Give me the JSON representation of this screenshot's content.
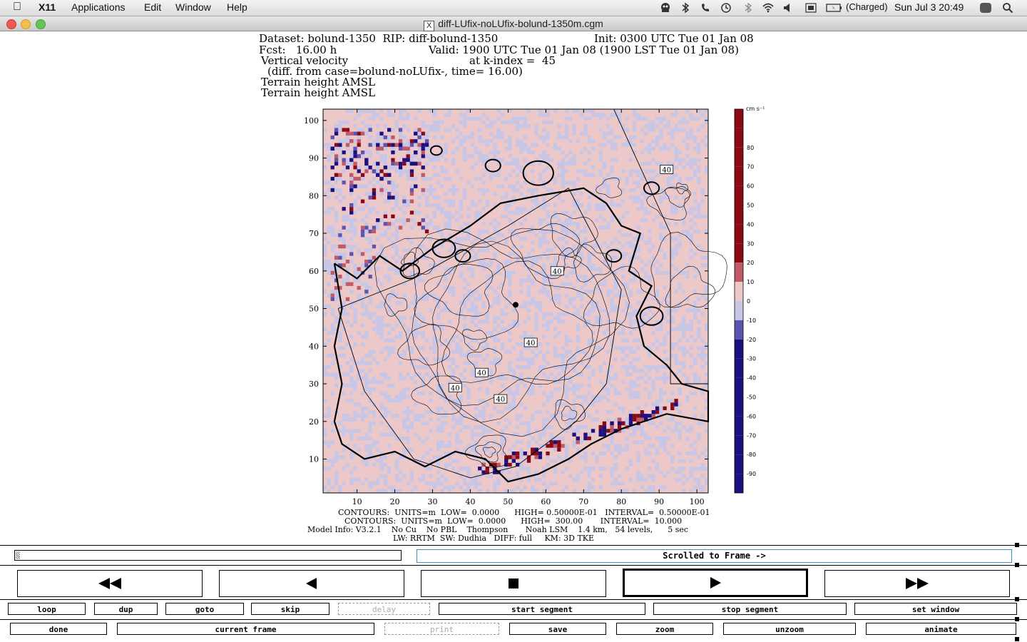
{
  "menubar": {
    "apple": "",
    "app_name": "X11",
    "menus": [
      "Applications",
      "Edit",
      "Window",
      "Help"
    ],
    "battery": "(Charged)",
    "clock": "Sun Jul 3  20:49",
    "status_icons": [
      "ghost-icon",
      "bluetooth-icon",
      "phone-icon",
      "time-machine-icon",
      "bluetooth-icon",
      "wifi-icon",
      "volume-icon",
      "keyboard-icon",
      "battery-icon",
      "user-icon",
      "spotlight-icon"
    ]
  },
  "window": {
    "title": "diff-LUfix-noLUfix-bolund-1350m.cgm",
    "title_icon": "X"
  },
  "plot": {
    "header_line1_left": "Dataset: bolund-1350  RIP: diff-bolund-1350",
    "header_line1_right": "Init: 0300 UTC Tue 01 Jan 08",
    "header_line2_left": "Fcst:   16.00 h",
    "header_line2_right": "Valid: 1900 UTC Tue 01 Jan 08 (1900 LST Tue 01 Jan 08)",
    "header_line3_left": "Vertical velocity",
    "header_line3_right": "at k-index =  45",
    "header_line4": "(diff. from case=bolund-noLUfix-, time= 16.00)",
    "header_line5": "Terrain height AMSL",
    "header_line6": "Terrain height AMSL",
    "colorbar_units": "cm s⁻¹",
    "contour_labels": [
      "40",
      "40",
      "40",
      "40",
      "40",
      "40"
    ],
    "footer_line1": "CONTOURS:  UNITS=m  LOW=  0.0000      HIGH= 0.50000E-01   INTERVAL=  0.50000E-01",
    "footer_line2": "CONTOURS:  UNITS=m  LOW=  0.0000      HIGH=  300.00       INTERVAL=  10.000",
    "footer_line3": "Model Info: V3.2.1    No Cu    No PBL    Thompson       Noah LSM    1.4 km,   54 levels,      5 sec",
    "footer_line4": "LW: RRTM  SW: Dudhia   DIFF: full     KM: 3D TKE"
  },
  "chart_data": {
    "type": "heatmap",
    "title": "Vertical velocity",
    "xlabel": "",
    "ylabel": "",
    "xlim": [
      1,
      103
    ],
    "ylim": [
      1,
      103
    ],
    "x_ticks": [
      10,
      20,
      30,
      40,
      50,
      60,
      70,
      80,
      90,
      100
    ],
    "y_ticks": [
      10,
      20,
      30,
      40,
      50,
      60,
      70,
      80,
      90,
      100
    ],
    "colorbar_ticks": [
      80,
      70,
      60,
      50,
      40,
      30,
      20,
      10,
      0,
      -10,
      -20,
      -30,
      -40,
      -50,
      -60,
      -70,
      -80,
      -90
    ],
    "colorbar_range": [
      -100,
      100
    ],
    "colors": {
      "strong_negative": "#1c1080",
      "negative": "#5b55b0",
      "weak_negative": "#c8c6e6",
      "weak_positive": "#ecc8c8",
      "positive": "#c05a66",
      "strong_positive": "#8a0a14"
    },
    "overlays": [
      "Terrain height AMSL contours (interval 10 m)",
      "Land mask contour"
    ]
  },
  "controls": {
    "frame_status": "Scrolled to Frame ->",
    "nav_buttons": [
      "fast-rewind-icon",
      "step-back-icon",
      "stop-icon",
      "play-icon",
      "fast-forward-icon"
    ],
    "row1": [
      {
        "label": "loop",
        "enabled": true
      },
      {
        "label": "dup",
        "enabled": true
      },
      {
        "label": "goto",
        "enabled": true
      },
      {
        "label": "skip",
        "enabled": true
      },
      {
        "label": "delay",
        "enabled": false
      },
      {
        "label": "start segment",
        "enabled": true
      },
      {
        "label": "stop segment",
        "enabled": true
      },
      {
        "label": "set window",
        "enabled": true
      }
    ],
    "row2": [
      {
        "label": "done",
        "enabled": true
      },
      {
        "label": "current frame",
        "enabled": true
      },
      {
        "label": "print",
        "enabled": false
      },
      {
        "label": "save",
        "enabled": true
      },
      {
        "label": "zoom",
        "enabled": true
      },
      {
        "label": "unzoom",
        "enabled": true
      },
      {
        "label": "animate",
        "enabled": true
      }
    ]
  }
}
